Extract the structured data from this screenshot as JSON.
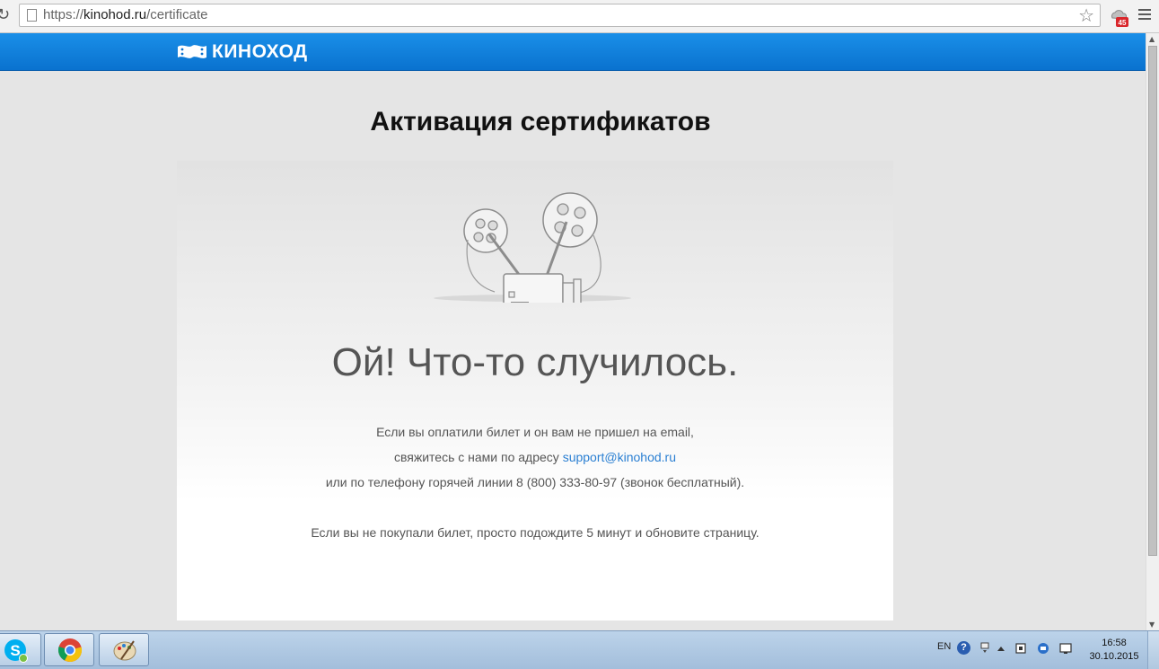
{
  "browser": {
    "url_scheme": "https://",
    "url_host": "kinohod.ru",
    "url_path": "/certificate",
    "reload_glyph": "↻",
    "star_glyph": "☆",
    "extension_badge": "45"
  },
  "site": {
    "logo_text": "КИНОХОД",
    "accent_color": "#0a7ad6"
  },
  "page": {
    "title": "Активация сертификатов",
    "error_heading": "Ой! Что-то случилось.",
    "line1": "Если вы оплатили билет и он вам не пришел на email,",
    "line2_prefix": "свяжитесь с нами по адресу ",
    "support_email": "support@kinohod.ru",
    "line3": "или по телефону горячей линии 8 (800) 333-80-97 (звонок бесплатный).",
    "line4": "Если вы не покупали билет, просто подождите 5 минут и обновите страницу."
  },
  "taskbar": {
    "apps": [
      {
        "name": "skype-icon"
      },
      {
        "name": "chrome-icon"
      },
      {
        "name": "paint-icon"
      }
    ],
    "tray": {
      "language": "EN",
      "help_glyph": "?"
    },
    "time": "16:58",
    "date": "30.10.2015"
  },
  "scrollbar": {
    "up_glyph": "▲",
    "down_glyph": "▼"
  }
}
